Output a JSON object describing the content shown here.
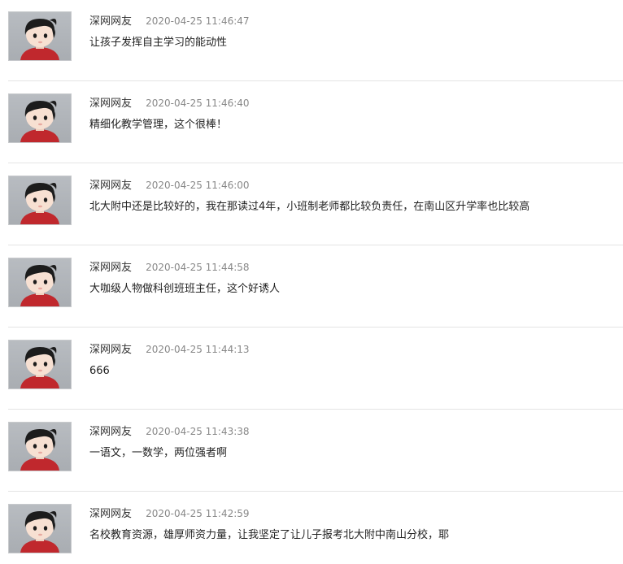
{
  "comments": [
    {
      "author": "深网网友",
      "time": "2020-04-25 11:46:47",
      "text": "让孩子发挥自主学习的能动性",
      "avatar_icon": "cartoon-boy-avatar"
    },
    {
      "author": "深网网友",
      "time": "2020-04-25 11:46:40",
      "text": "精细化教学管理，这个很棒！",
      "avatar_icon": "cartoon-boy-avatar"
    },
    {
      "author": "深网网友",
      "time": "2020-04-25 11:46:00",
      "text": "北大附中还是比较好的，我在那读过4年，小班制老师都比较负责任，在南山区升学率也比较高",
      "avatar_icon": "cartoon-boy-avatar"
    },
    {
      "author": "深网网友",
      "time": "2020-04-25 11:44:58",
      "text": "大咖级人物做科创班班主任，这个好诱人",
      "avatar_icon": "cartoon-boy-avatar"
    },
    {
      "author": "深网网友",
      "time": "2020-04-25 11:44:13",
      "text": "666",
      "avatar_icon": "cartoon-boy-avatar"
    },
    {
      "author": "深网网友",
      "time": "2020-04-25 11:43:38",
      "text": "一语文，一数学，两位强者啊",
      "avatar_icon": "cartoon-boy-avatar"
    },
    {
      "author": "深网网友",
      "time": "2020-04-25 11:42:59",
      "text": "名校教育资源，雄厚师资力量，让我坚定了让儿子报考北大附中南山分校，耶",
      "avatar_icon": "cartoon-boy-avatar"
    }
  ],
  "colors": {
    "avatar_bg": "#b8bcc1",
    "shirt": "#c0282d",
    "hair": "#1c1c1c",
    "skin": "#f7e0d2",
    "divider": "#e4e4e4"
  }
}
